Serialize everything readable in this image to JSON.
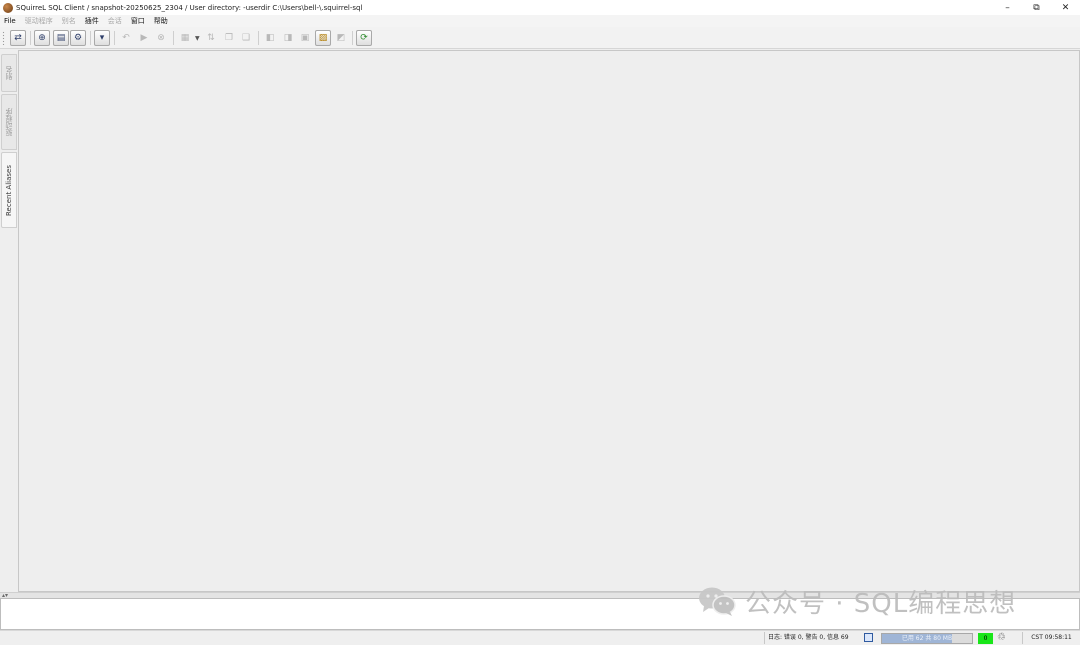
{
  "window": {
    "title": "SQuirreL SQL Client / snapshot-20250625_2304 / User directory: -userdir C:\\Users\\bell-\\.squirrel-sql",
    "controls": {
      "minimize": "–",
      "maximize": "⧉",
      "close": "✕"
    }
  },
  "menubar": {
    "items": [
      {
        "label": "File",
        "enabled": true
      },
      {
        "label": "驱动程序",
        "enabled": false
      },
      {
        "label": "别名",
        "enabled": false
      },
      {
        "label": "插件",
        "enabled": true
      },
      {
        "label": "会话",
        "enabled": false
      },
      {
        "label": "窗口",
        "enabled": true
      },
      {
        "label": "帮助",
        "enabled": true
      }
    ]
  },
  "toolbar": {
    "buttons": [
      {
        "icon": "connect-icon",
        "glyph": "⇄",
        "enabled": true
      },
      {
        "icon": "new-session-icon",
        "glyph": "⊕",
        "enabled": true
      },
      {
        "icon": "sql-editor-icon",
        "glyph": "▤",
        "enabled": true
      },
      {
        "icon": "object-tree-icon",
        "glyph": "⚙",
        "enabled": true
      },
      {
        "icon": "filter-icon",
        "glyph": "▾",
        "enabled": true
      },
      {
        "icon": "commit-icon",
        "glyph": "↶",
        "enabled": false
      },
      {
        "icon": "run-icon",
        "glyph": "▶",
        "enabled": false
      },
      {
        "icon": "stop-icon",
        "glyph": "⊗",
        "enabled": false
      },
      {
        "icon": "sql-history-icon",
        "glyph": "▦",
        "enabled": false
      },
      {
        "icon": "sort-icon",
        "glyph": "⇅",
        "enabled": false
      },
      {
        "icon": "copy-icon",
        "glyph": "❐",
        "enabled": false
      },
      {
        "icon": "paste-icon",
        "glyph": "❑",
        "enabled": false
      },
      {
        "icon": "previous-tab-icon",
        "glyph": "◧",
        "enabled": false
      },
      {
        "icon": "next-tab-icon",
        "glyph": "◨",
        "enabled": false
      },
      {
        "icon": "close-tab-icon",
        "glyph": "▣",
        "enabled": false
      },
      {
        "icon": "open-file-icon",
        "glyph": "▨",
        "enabled": true
      },
      {
        "icon": "bookmark-icon",
        "glyph": "◩",
        "enabled": false
      },
      {
        "icon": "refresh-icon",
        "glyph": "⟳",
        "enabled": true
      }
    ]
  },
  "left_tabs": [
    {
      "label": "别名",
      "active": false
    },
    {
      "label": "驱动程序",
      "active": false
    },
    {
      "label": "Recent Aliases",
      "active": true
    }
  ],
  "statusbar": {
    "log_summary": "日志: 错误 0, 警告 0, 信息 69",
    "memory_text": "已用 62 共 80 MB",
    "memory_used_fraction": 0.78,
    "open_connections": "0",
    "clock": "CST 09:58:11"
  },
  "watermark": {
    "text": "公众号 · SQL编程思想"
  },
  "colors": {
    "connection_ok": "#19e619",
    "memory_fill": "#9fb5d6"
  }
}
